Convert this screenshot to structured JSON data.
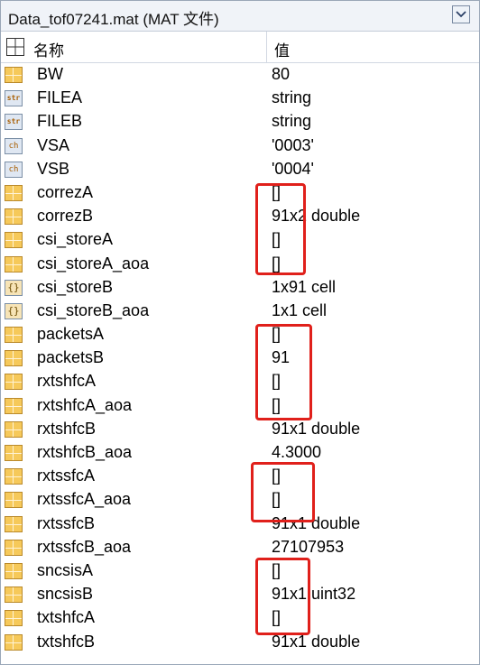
{
  "window": {
    "title": "Data_tof07241.mat  (MAT 文件)"
  },
  "columns": {
    "name": "名称",
    "value": "值"
  },
  "variables": [
    {
      "name": "BW",
      "value": "80",
      "icon": "numeric-array-icon"
    },
    {
      "name": "FILEA",
      "value": "string",
      "icon": "string-icon"
    },
    {
      "name": "FILEB",
      "value": "string",
      "icon": "string-icon"
    },
    {
      "name": "VSA",
      "value": "'0003'",
      "icon": "char-icon"
    },
    {
      "name": "VSB",
      "value": "'0004'",
      "icon": "char-icon"
    },
    {
      "name": "correzA",
      "value": "[]",
      "icon": "numeric-array-icon"
    },
    {
      "name": "correzB",
      "value": "91x2 double",
      "icon": "numeric-array-icon"
    },
    {
      "name": "csi_storeA",
      "value": "[]",
      "icon": "numeric-array-icon"
    },
    {
      "name": "csi_storeA_aoa",
      "value": "[]",
      "icon": "numeric-array-icon"
    },
    {
      "name": "csi_storeB",
      "value": "1x91 cell",
      "icon": "cell-icon"
    },
    {
      "name": "csi_storeB_aoa",
      "value": "1x1 cell",
      "icon": "cell-icon"
    },
    {
      "name": "packetsA",
      "value": "[]",
      "icon": "numeric-array-icon"
    },
    {
      "name": "packetsB",
      "value": "91",
      "icon": "numeric-array-icon"
    },
    {
      "name": "rxtshfcA",
      "value": "[]",
      "icon": "numeric-array-icon"
    },
    {
      "name": "rxtshfcA_aoa",
      "value": "[]",
      "icon": "numeric-array-icon"
    },
    {
      "name": "rxtshfcB",
      "value": "91x1 double",
      "icon": "numeric-array-icon"
    },
    {
      "name": "rxtshfcB_aoa",
      "value": "4.3000",
      "icon": "numeric-array-icon"
    },
    {
      "name": "rxtssfcA",
      "value": "[]",
      "icon": "numeric-array-icon"
    },
    {
      "name": "rxtssfcA_aoa",
      "value": "[]",
      "icon": "numeric-array-icon"
    },
    {
      "name": "rxtssfcB",
      "value": "91x1 double",
      "icon": "numeric-array-icon"
    },
    {
      "name": "rxtssfcB_aoa",
      "value": "27107953",
      "icon": "numeric-array-icon"
    },
    {
      "name": "sncsisA",
      "value": "[]",
      "icon": "numeric-array-icon"
    },
    {
      "name": "sncsisB",
      "value": "91x1 uint32",
      "icon": "numeric-array-icon"
    },
    {
      "name": "txtshfcA",
      "value": "[]",
      "icon": "numeric-array-icon"
    },
    {
      "name": "txtshfcB",
      "value": "91x1 double",
      "icon": "numeric-array-icon"
    }
  ],
  "colors": {
    "highlight_box": "#e0201b"
  }
}
